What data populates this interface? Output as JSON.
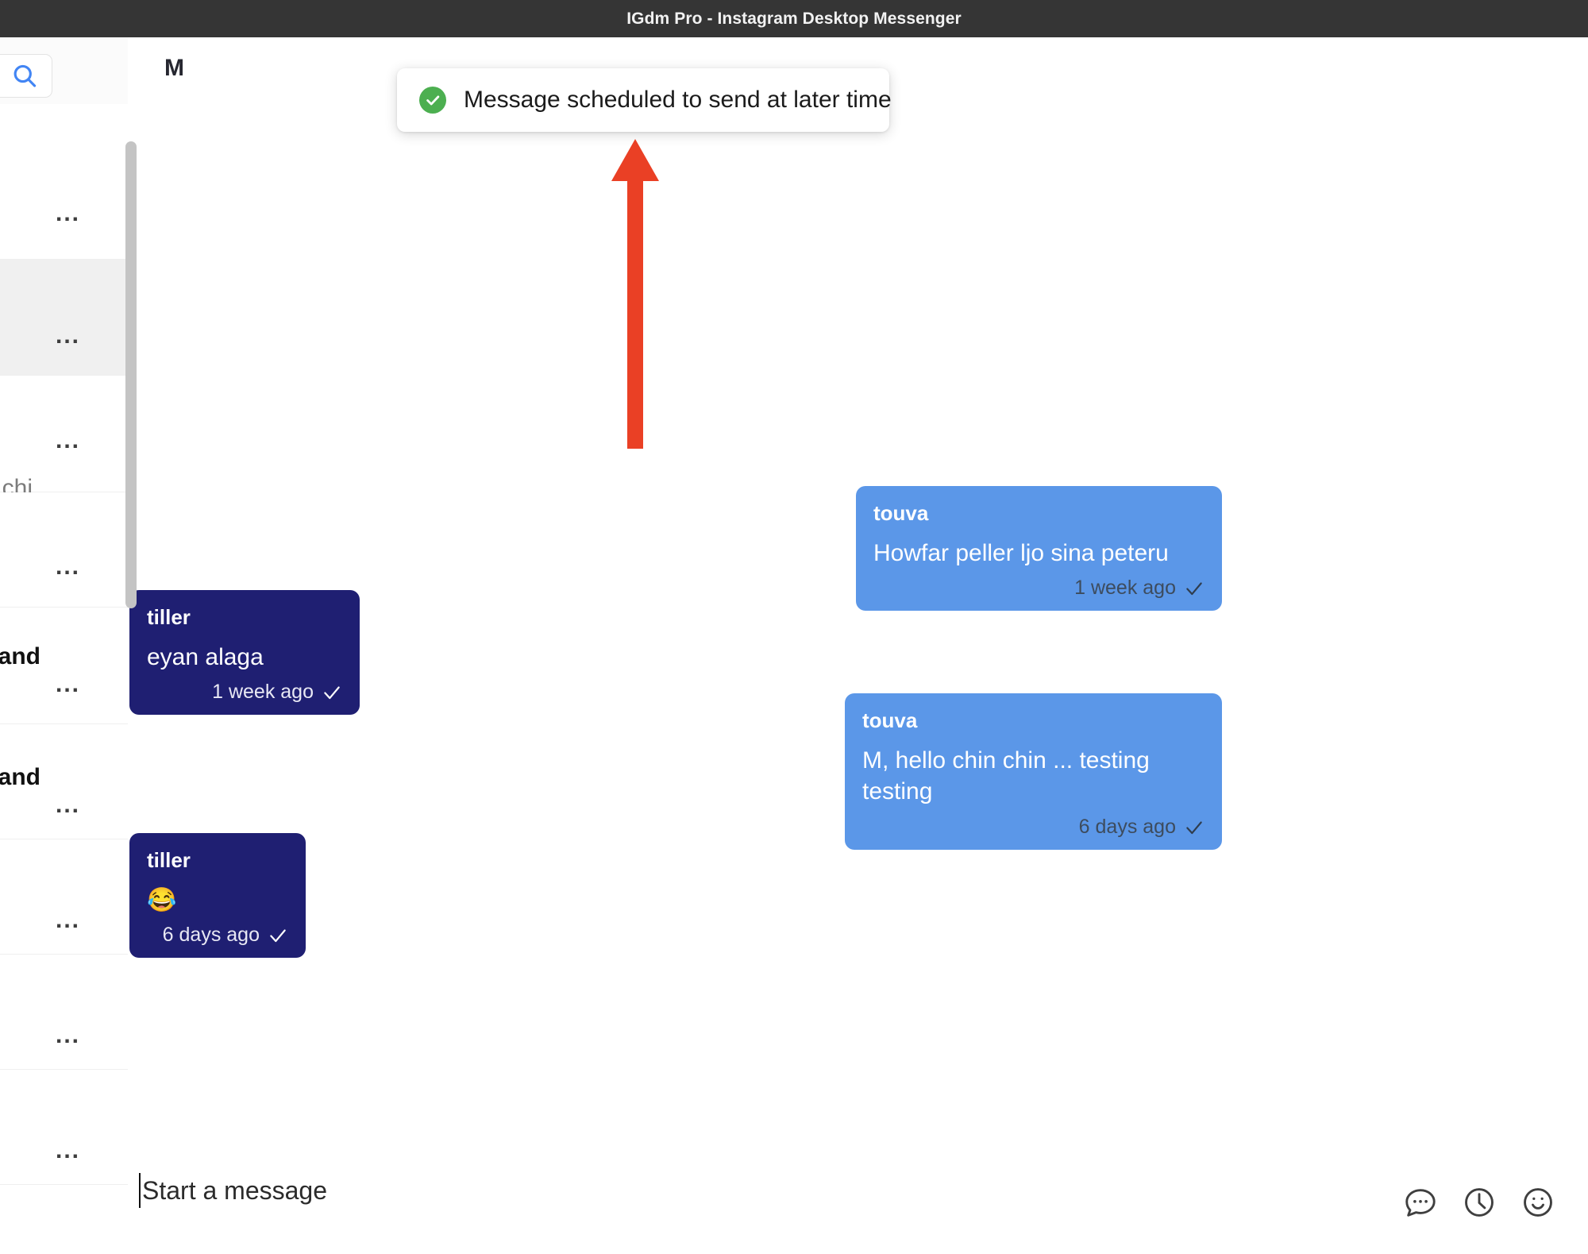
{
  "window": {
    "title": "IGdm Pro - Instagram Desktop Messenger"
  },
  "colors": {
    "titlebar_bg": "#353535",
    "outgoing_bubble": "#5b97e8",
    "incoming_bubble": "#1f1f72",
    "toast_success": "#4caf50",
    "annotation_arrow": "#ea4025",
    "selected_row": "#f0f0f0",
    "search_icon": "#4285f4"
  },
  "sidebar": {
    "search": {
      "icon": "search-icon",
      "value": "",
      "placeholder": ""
    },
    "conversations": [
      {
        "name": "",
        "snippet": "",
        "menu": "...",
        "selected": false
      },
      {
        "name": "",
        "snippet": "",
        "menu": "...",
        "selected": true
      },
      {
        "name": "",
        "snippet": "chi...",
        "menu": "...",
        "selected": false
      },
      {
        "name": "",
        "snippet": "",
        "menu": "...",
        "selected": false
      },
      {
        "name": "and",
        "snippet": "",
        "menu": "...",
        "selected": false
      },
      {
        "name": "o and",
        "snippet": "",
        "menu": "...",
        "selected": false
      },
      {
        "name": "",
        "snippet": "",
        "menu": "...",
        "selected": false
      },
      {
        "name": "",
        "snippet": "",
        "menu": "...",
        "selected": false
      },
      {
        "name": "",
        "snippet": "",
        "menu": "...",
        "selected": false
      }
    ]
  },
  "chat": {
    "title": "M",
    "messages": [
      {
        "author": "touva",
        "text": "Howfar peller ljo sina peteru",
        "time": "1 week ago",
        "direction": "outgoing",
        "status_icon": "check-icon"
      },
      {
        "author": "tiller",
        "text": "eyan alaga",
        "time": "1 week ago",
        "direction": "incoming",
        "status_icon": "check-icon"
      },
      {
        "author": "touva",
        "text": "M, hello chin chin ... testing testing",
        "time": "6 days ago",
        "direction": "outgoing",
        "status_icon": "check-icon"
      },
      {
        "author": "tiller",
        "text": "😂",
        "time": "6 days ago",
        "direction": "incoming",
        "status_icon": "check-icon"
      }
    ]
  },
  "composer": {
    "placeholder": "Start a message",
    "value": "",
    "actions": [
      {
        "name": "quick-reply-icon",
        "label": "Quick replies"
      },
      {
        "name": "schedule-clock-icon",
        "label": "Schedule message"
      },
      {
        "name": "emoji-smiley-icon",
        "label": "Emoji"
      }
    ]
  },
  "toast": {
    "icon": "check-circle-icon",
    "message": "Message scheduled to send at later time"
  },
  "annotation": {
    "type": "arrow",
    "direction": "up",
    "color": "#ea4025",
    "points_to": "toast"
  }
}
